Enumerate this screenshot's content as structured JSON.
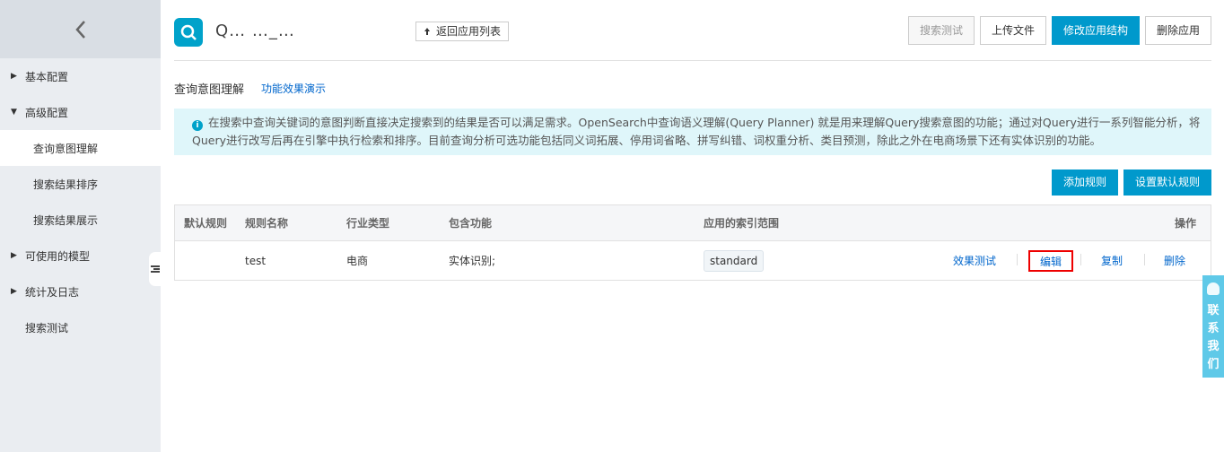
{
  "sidebar": {
    "items": [
      {
        "label": "基本配置"
      },
      {
        "label": "高级配置"
      },
      {
        "label": "查询意图理解"
      },
      {
        "label": "搜索结果排序"
      },
      {
        "label": "搜索结果展示"
      },
      {
        "label": "可使用的模型"
      },
      {
        "label": "统计及日志"
      },
      {
        "label": "搜索测试"
      }
    ]
  },
  "header": {
    "app_name": "Q… …_…",
    "back_label": "返回应用列表",
    "buttons": {
      "search_test": "搜索测试",
      "upload": "上传文件",
      "modify_structure": "修改应用结构",
      "delete_app": "删除应用"
    }
  },
  "section": {
    "title": "查询意图理解",
    "demo_link": "功能效果演示"
  },
  "notice": "在搜索中查询关键词的意图判断直接决定搜索到的结果是否可以满足需求。OpenSearch中查询语义理解(Query Planner) 就是用来理解Query搜索意图的功能；通过对Query进行一系列智能分析，将Query进行改写后再在引擎中执行检索和排序。目前查询分析可选功能包括同义词拓展、停用词省略、拼写纠错、词权重分析、类目预测，除此之外在电商场景下还有实体识别的功能。",
  "rule_buttons": {
    "add": "添加规则",
    "set_default": "设置默认规则"
  },
  "table": {
    "headers": {
      "default_rule": "默认规则",
      "rule_name": "规则名称",
      "industry": "行业类型",
      "features": "包含功能",
      "index_scope": "应用的索引范围",
      "actions": "操作"
    },
    "rows": [
      {
        "rule_name": "test",
        "industry": "电商",
        "features": "实体识别;",
        "index_scope": "standard",
        "actions": {
          "test": "效果测试",
          "edit": "编辑",
          "copy": "复制",
          "delete": "删除"
        }
      }
    ]
  },
  "contact": [
    "联",
    "系",
    "我",
    "们"
  ],
  "colors": {
    "primary": "#0099cc",
    "link": "#0066cc",
    "notice_bg": "#dff6fa",
    "highlight": "#ee0000"
  }
}
